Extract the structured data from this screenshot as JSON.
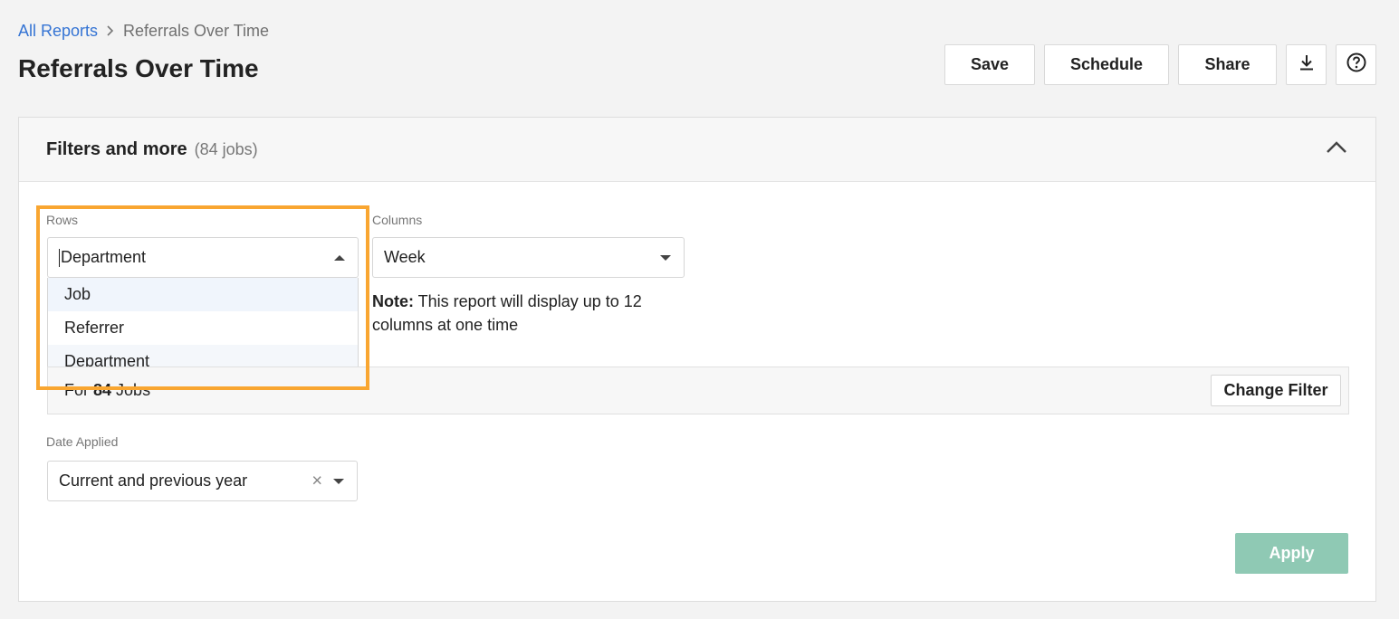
{
  "breadcrumb": {
    "root": "All Reports",
    "current": "Referrals Over Time"
  },
  "page": {
    "title": "Referrals Over Time"
  },
  "toolbar": {
    "save": "Save",
    "schedule": "Schedule",
    "share": "Share",
    "download_icon": "download-icon",
    "help_icon": "help-icon"
  },
  "filters": {
    "title": "Filters and more",
    "count": "(84 jobs)",
    "rows": {
      "label": "Rows",
      "value": "Department",
      "options": [
        "Job",
        "Referrer",
        "Department"
      ]
    },
    "columns": {
      "label": "Columns",
      "value": "Week"
    },
    "note": {
      "bold": "Note:",
      "text": " This report will display up to 12 columns at one time"
    },
    "job_filter": {
      "prefix": "For ",
      "count": "84",
      "suffix": " Jobs",
      "button": "Change Filter"
    },
    "date_applied": {
      "label": "Date Applied",
      "value": "Current and previous year",
      "clear": "×"
    },
    "apply": "Apply"
  },
  "colors": {
    "accent_link": "#3574d4",
    "highlight": "#f9a631",
    "apply_bg": "#8fc9b4"
  }
}
